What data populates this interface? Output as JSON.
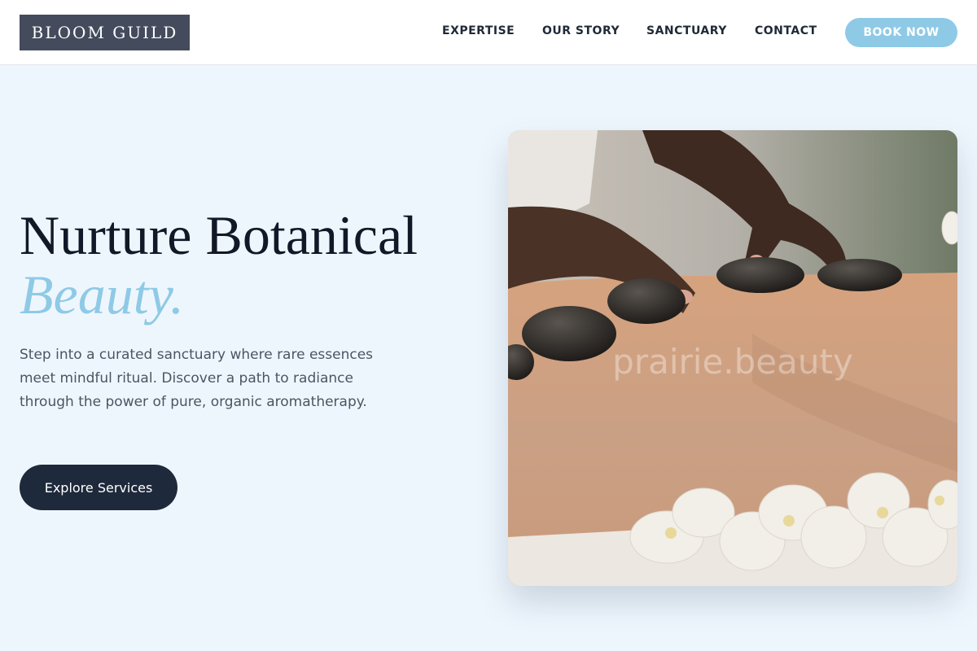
{
  "brand": {
    "name": "BLOOM GUILD"
  },
  "nav": {
    "items": [
      {
        "label": "EXPERTISE"
      },
      {
        "label": "OUR STORY"
      },
      {
        "label": "SANCTUARY"
      },
      {
        "label": "CONTACT"
      }
    ],
    "cta": "BOOK NOW"
  },
  "hero": {
    "title": "Nurture Botanical",
    "accent": "Beauty.",
    "description": "Step into a curated sanctuary where rare essences meet mindful ritual. Discover a path to radiance through the power of pure, organic aromatherapy.",
    "button": "Explore Services",
    "image": {
      "description_icon": "hot-stone-massage-photo",
      "watermark": "prairie.beauty"
    }
  },
  "colors": {
    "accent": "#8ecae6",
    "dark": "#1e293b",
    "logo_bg": "#434b5c",
    "page_bg": "#eef6fd"
  }
}
